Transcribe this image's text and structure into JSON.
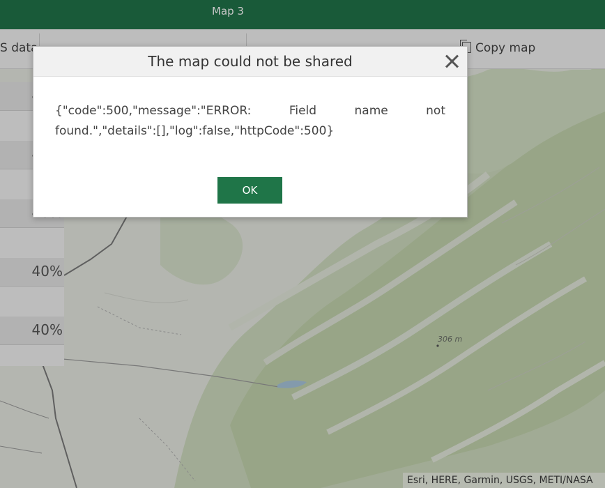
{
  "app": {
    "title": "Map 3"
  },
  "toolbar": {
    "gis_data_label": "S data",
    "copy_map_label": "Copy map",
    "copy_icon": "copy-icon"
  },
  "left_panel": {
    "values": [
      "40%"
    ]
  },
  "dialog": {
    "title": "The map could not be shared",
    "message": "{\"code\":500,\"message\":\"ERROR: Field name not found.\",\"details\":[],\"log\":false,\"httpCode\":500}",
    "ok_label": "OK",
    "close_icon": "close-icon"
  },
  "map": {
    "elevation_label": "306 m",
    "attribution": "Esri, HERE, Garmin, USGS, METI/NASA"
  },
  "colors": {
    "header_green": "#21744a",
    "button_green": "#1f7548"
  }
}
